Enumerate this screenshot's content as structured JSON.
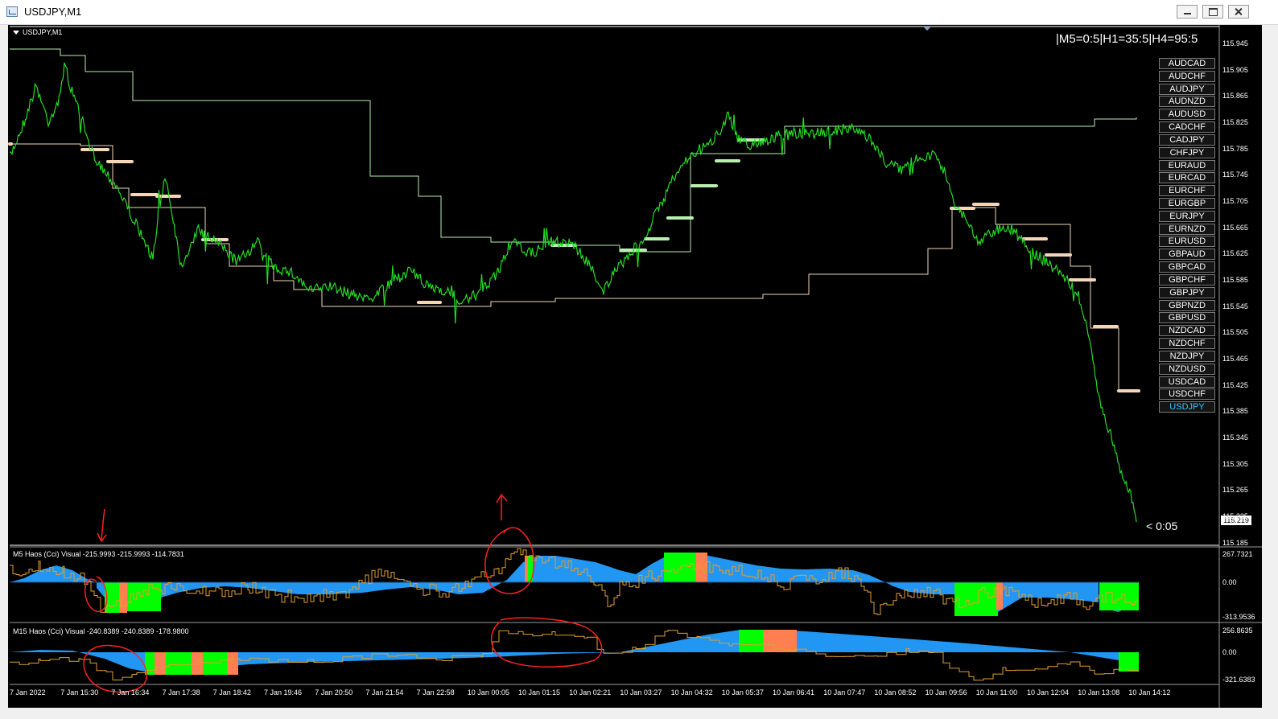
{
  "window": {
    "title": "USDJPY,M1"
  },
  "chart": {
    "symbol_label": "USDJPY,M1",
    "timeframe_status": "|M5=0:5|H1=35:5|H4=95:5",
    "countdown": "< 0:05",
    "current_price": "115.219",
    "colors": {
      "background": "#000000",
      "price_line": "#22dd22",
      "level_line": "#f5d7b8",
      "indicator_blue": "#2196f3",
      "indicator_green": "#00ff00",
      "indicator_orange": "#ff7f50",
      "indicator_line": "#e0a030",
      "annotation": "#ff2020"
    }
  },
  "symbols": [
    "AUDCAD",
    "AUDCHF",
    "AUDJPY",
    "AUDNZD",
    "AUDUSD",
    "CADCHF",
    "CADJPY",
    "CHFJPY",
    "EURAUD",
    "EURCAD",
    "EURCHF",
    "EURGBP",
    "EURJPY",
    "EURNZD",
    "EURUSD",
    "GBPAUD",
    "GBPCAD",
    "GBPCHF",
    "GBPJPY",
    "GBPNZD",
    "GBPUSD",
    "NZDCAD",
    "NZDCHF",
    "NZDJPY",
    "NZDUSD",
    "USDCAD",
    "USDCHF",
    "USDJPY"
  ],
  "active_symbol": "USDJPY",
  "price_axis": [
    "115.945",
    "115.905",
    "115.865",
    "115.825",
    "115.785",
    "115.745",
    "115.705",
    "115.665",
    "115.625",
    "115.585",
    "115.545",
    "115.505",
    "115.465",
    "115.425",
    "115.385",
    "115.345",
    "115.305",
    "115.265",
    "115.225",
    "115.185"
  ],
  "indicator1": {
    "title": "M5 Haos (Cci) Visual -215.9993 -215.9993 -114.7831",
    "axis": [
      "267.7321",
      "0.00",
      "-313.9536"
    ]
  },
  "indicator2": {
    "title": "M15 Haos (Cci) Visual -240.8389 -240.8389 -178.9800",
    "axis": [
      "256.8635",
      "0.00",
      "-321.6383"
    ]
  },
  "time_axis": [
    "7 Jan 2022",
    "7 Jan 15:30",
    "7 Jan 16:34",
    "7 Jan 17:38",
    "7 Jan 18:42",
    "7 Jan 19:46",
    "7 Jan 20:50",
    "7 Jan 21:54",
    "7 Jan 22:58",
    "10 Jan 00:05",
    "10 Jan 01:15",
    "10 Jan 02:21",
    "10 Jan 03:27",
    "10 Jan 04:32",
    "10 Jan 05:37",
    "10 Jan 06:41",
    "10 Jan 07:47",
    "10 Jan 08:52",
    "10 Jan 09:56",
    "10 Jan 11:00",
    "10 Jan 12:04",
    "10 Jan 13:08",
    "10 Jan 14:12"
  ]
}
